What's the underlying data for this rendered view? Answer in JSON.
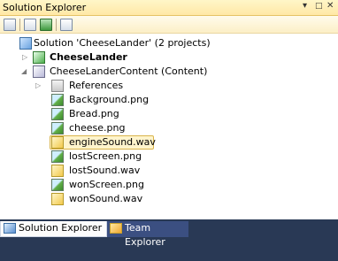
{
  "window": {
    "title": "Solution Explorer",
    "controls": {
      "dropdown": "▾",
      "pin": "□",
      "close": "✕"
    }
  },
  "toolbar": {
    "buttons": [
      "properties-icon",
      "show-all-files-icon",
      "refresh-icon",
      "view-class-diagram-icon"
    ]
  },
  "tree": {
    "solution": "Solution 'CheeseLander' (2 projects)",
    "project_main": "CheeseLander",
    "project_content": "CheeseLanderContent (Content)",
    "references": "References",
    "files": [
      {
        "name": "Background.png",
        "icon": "image-file-icon"
      },
      {
        "name": "Bread.png",
        "icon": "image-file-icon"
      },
      {
        "name": "cheese.png",
        "icon": "image-file-icon"
      },
      {
        "name": "engineSound.wav",
        "icon": "audio-file-icon"
      },
      {
        "name": "lostScreen.png",
        "icon": "image-file-icon"
      },
      {
        "name": "lostSound.wav",
        "icon": "audio-file-icon"
      },
      {
        "name": "wonScreen.png",
        "icon": "image-file-icon"
      },
      {
        "name": "wonSound.wav",
        "icon": "audio-file-icon"
      }
    ],
    "selected_file": "engineSound.wav"
  },
  "tabs": [
    {
      "label": "Solution Explorer",
      "active": true
    },
    {
      "label": "Team Explorer",
      "active": false
    }
  ],
  "colors": {
    "title_bar": "#ffe8a6",
    "selection": "#fff4cc",
    "tab_strip": "#293955",
    "inactive_tab": "#3b4f81"
  }
}
